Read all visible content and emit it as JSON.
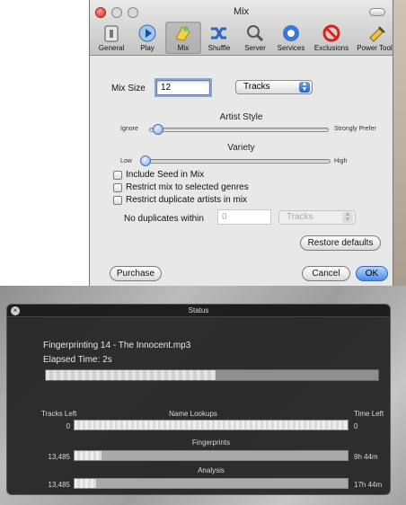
{
  "mix_window": {
    "title": "Mix",
    "toolbar": [
      {
        "label": "General",
        "icon": "general-icon"
      },
      {
        "label": "Play",
        "icon": "play-icon"
      },
      {
        "label": "Mix",
        "icon": "mix-icon",
        "selected": true
      },
      {
        "label": "Shuffle",
        "icon": "shuffle-icon"
      },
      {
        "label": "Server",
        "icon": "server-icon"
      },
      {
        "label": "Services",
        "icon": "services-icon"
      },
      {
        "label": "Exclusions",
        "icon": "exclusions-icon"
      },
      {
        "label": "Power Tools",
        "icon": "power-tools-icon"
      }
    ],
    "mix_size_label": "Mix Size",
    "mix_size_value": "12",
    "mix_unit": "Tracks",
    "artist_style": {
      "title": "Artist Style",
      "min_label": "Ignore",
      "max_label": "Strongly Prefer",
      "level": 0.05
    },
    "variety": {
      "title": "Variety",
      "min_label": "Low",
      "max_label": "High",
      "level": 0.02
    },
    "checkboxes": [
      {
        "label": "Include Seed in Mix",
        "checked": false
      },
      {
        "label": "Restrict mix to selected genres",
        "checked": false
      },
      {
        "label": "Restrict duplicate artists in mix",
        "checked": false
      }
    ],
    "no_duplicates_label": "No duplicates within",
    "no_duplicates_value": "0",
    "no_duplicates_unit": "Tracks",
    "restore_defaults": "Restore defaults",
    "purchase": "Purchase",
    "cancel": "Cancel",
    "ok": "OK"
  },
  "status_window": {
    "title": "Status",
    "current_file": "Fingerprinting 14 - The Innocent.mp3",
    "elapsed_label": "Elapsed Time:",
    "elapsed_value": "2s",
    "overall_progress": 0.51,
    "tracks_left_header": "Tracks Left",
    "time_left_header": "Time Left",
    "rows": [
      {
        "name": "Name Lookups",
        "tracks_left": "0",
        "time_left": "0",
        "progress": 1.0
      },
      {
        "name": "Fingerprints",
        "tracks_left": "13,485",
        "time_left": "9h 44m",
        "progress": 0.1
      },
      {
        "name": "Analysis",
        "tracks_left": "13,485",
        "time_left": "17h 44m",
        "progress": 0.08
      }
    ]
  },
  "colors": {
    "accent": "#3a7be0",
    "dark_panel": "#222222"
  }
}
